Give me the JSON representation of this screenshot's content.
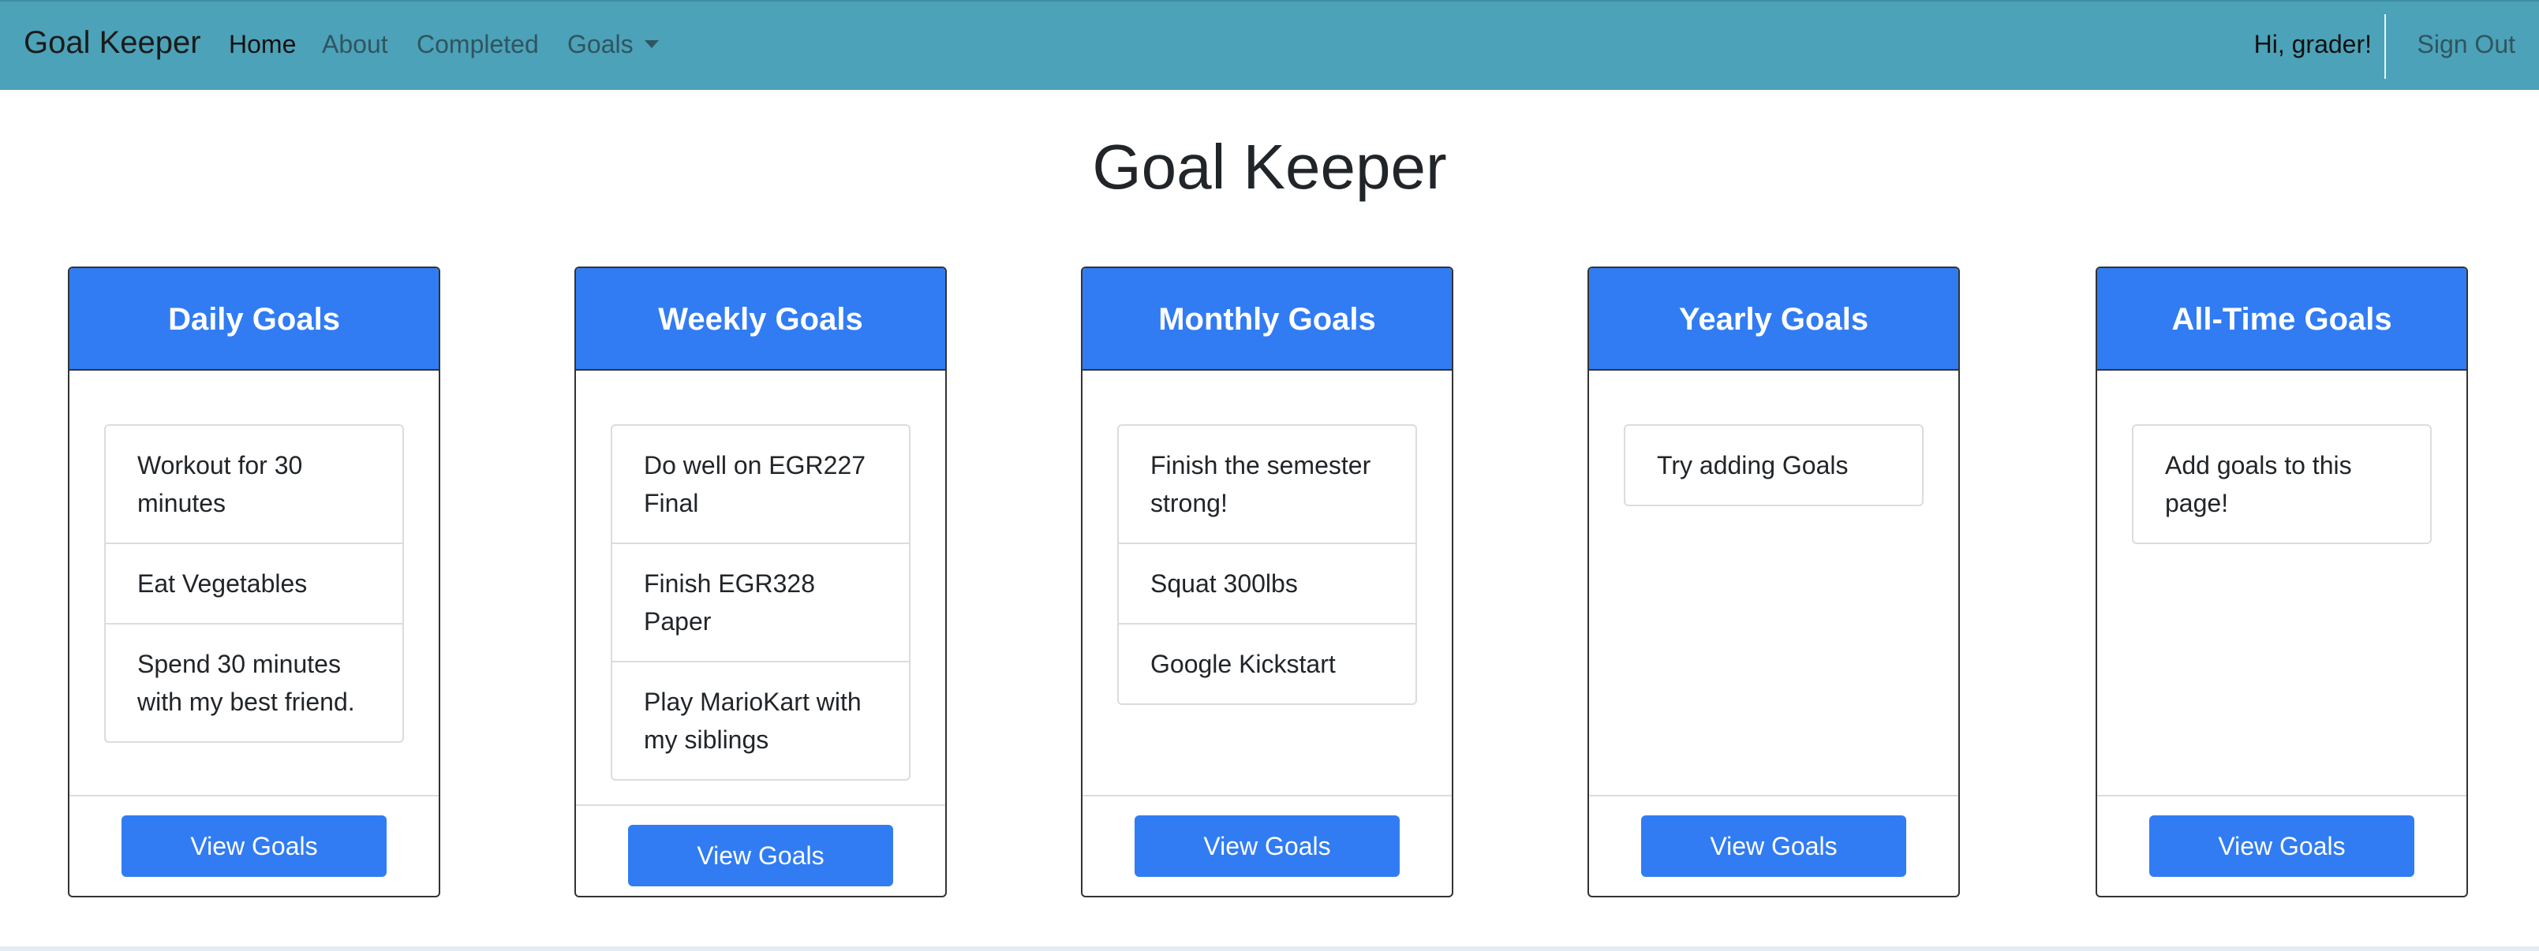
{
  "navbar": {
    "brand": "Goal Keeper",
    "links": [
      {
        "label": "Home",
        "active": true
      },
      {
        "label": "About",
        "active": false
      },
      {
        "label": "Completed",
        "active": false
      },
      {
        "label": "Goals",
        "active": false,
        "dropdown": true
      }
    ],
    "greeting": "Hi, grader!",
    "sign_out": "Sign Out"
  },
  "page": {
    "title": "Goal Keeper"
  },
  "cards": [
    {
      "header": "Daily Goals",
      "goals": [
        "Workout for 30 minutes",
        "Eat Vegetables",
        "Spend 30 minutes with my best friend."
      ],
      "button": "View Goals"
    },
    {
      "header": "Weekly Goals",
      "goals": [
        "Do well on EGR227 Final",
        "Finish EGR328 Paper",
        "Play MarioKart with my siblings"
      ],
      "button": "View Goals"
    },
    {
      "header": "Monthly Goals",
      "goals": [
        "Finish the semester strong!",
        "Squat 300lbs",
        "Google Kickstart"
      ],
      "button": "View Goals"
    },
    {
      "header": "Yearly Goals",
      "goals": [
        "Try adding Goals"
      ],
      "button": "View Goals"
    },
    {
      "header": "All-Time Goals",
      "goals": [
        "Add goals to this page!"
      ],
      "button": "View Goals"
    }
  ],
  "colors": {
    "navbar_bg": "#4ca2b8",
    "accent": "#317cf3"
  },
  "icons": {
    "goals_dropdown": "caret-down-icon"
  }
}
